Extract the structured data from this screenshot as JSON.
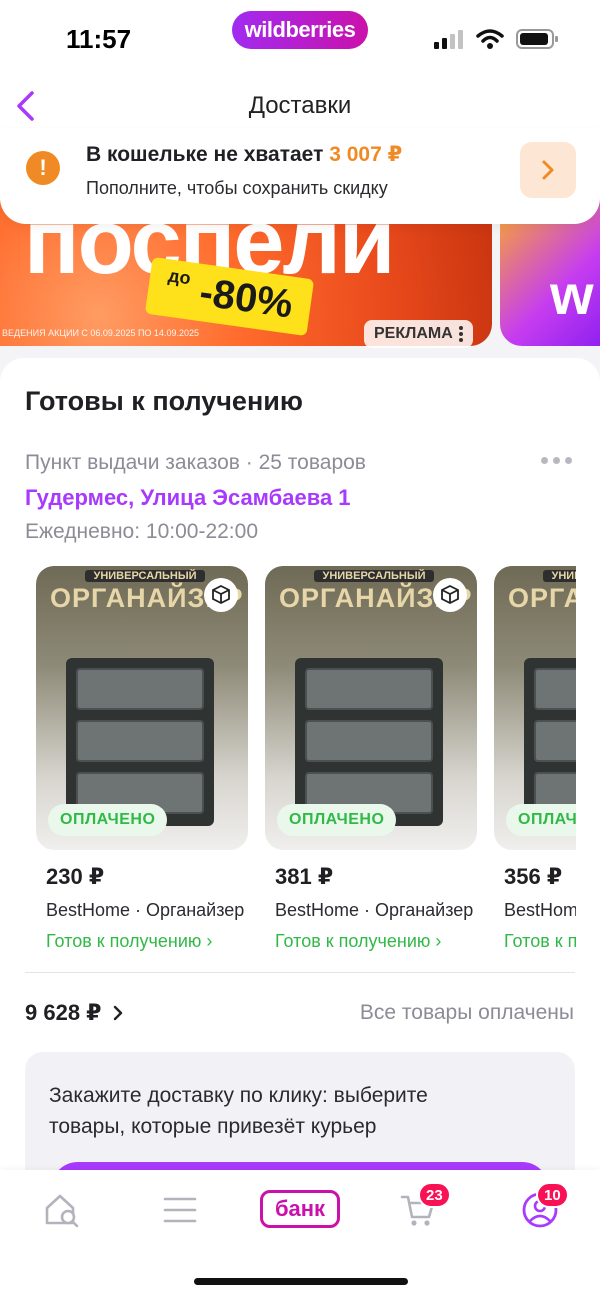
{
  "status": {
    "time": "11:57",
    "brand": "wildberries"
  },
  "header": {
    "title": "Доставки"
  },
  "wallet": {
    "title_prefix": "В кошельке не хватает ",
    "amount": "3 007 ₽",
    "subtitle": "Пополните, чтобы сохранить скидку"
  },
  "banner": {
    "headline": "поспели",
    "discount_prefix": "до",
    "discount": "-80%",
    "fine_print": "ВЕДЕНИЯ АКЦИИ С 06.09.2025 ПО 14.09.2025",
    "ad_label": "РЕКЛАМА",
    "side_text": "w"
  },
  "orders": {
    "title": "Готовы к получению",
    "pickup_info": "Пункт выдачи заказов · 25 товаров",
    "address": "Гудермес, Улица Эсамбаева 1",
    "hours": "Ежедневно: 10:00-22:00",
    "products": [
      {
        "banner_small": "УНИВЕРСАЛЬНЫЙ",
        "banner_big": "ОРГАНАЙЗЕР",
        "badge": "ОПЛАЧЕНО",
        "price": "230 ₽",
        "name": "BestHome · Органайзер",
        "status": "Готов к получению ›"
      },
      {
        "banner_small": "УНИВЕРСАЛЬНЫЙ",
        "banner_big": "ОРГАНАЙЗЕР",
        "badge": "ОПЛАЧЕНО",
        "price": "381 ₽",
        "name": "BestHome · Органайзер",
        "status": "Готов к получению ›"
      },
      {
        "banner_small": "УНИВЕРСАЛЬНЫЙ",
        "banner_big": "ОРГАНАЙЗЕР",
        "badge": "ОПЛАЧЕНО",
        "price": "356 ₽",
        "name": "BestHome · Органайзер",
        "status": "Готов к получению ›"
      }
    ],
    "total": "9 628 ₽",
    "paid_status": "Все товары оплачены"
  },
  "courier": {
    "text": "Закажите доставку по клику: выберите товары, которые привезёт курьер"
  },
  "tabs": {
    "bank_label": "банк",
    "cart_count": "23",
    "profile_count": "10"
  },
  "colors": {
    "accent": "#a73afd",
    "brand": "#cb11ab",
    "warning": "#f08a24",
    "success": "#30b947",
    "badge": "#f91155"
  }
}
